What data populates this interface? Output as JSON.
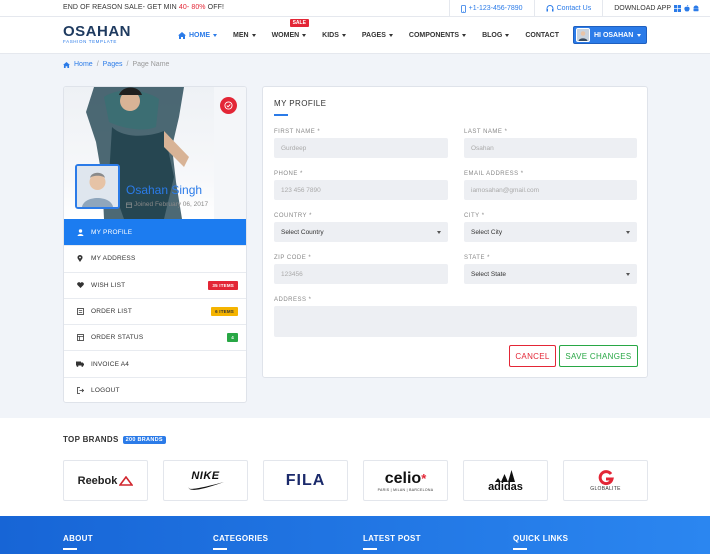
{
  "topbar": {
    "promo_prefix": "END OF REASON SALE- GET MIN ",
    "promo_highlight": "40- 80%",
    "promo_suffix": " OFF!",
    "phone": "+1-123-456-7890",
    "contact": "Contact Us",
    "download": "DOWNLOAD APP"
  },
  "brand": {
    "name": "OSAHAN",
    "tagline": "FASHION TEMPLATE"
  },
  "nav": {
    "items": [
      {
        "label": "HOME",
        "active": true
      },
      {
        "label": "MEN"
      },
      {
        "label": "WOMEN",
        "badge": "SALE"
      },
      {
        "label": "KIDS"
      },
      {
        "label": "PAGES"
      },
      {
        "label": "COMPONENTS"
      },
      {
        "label": "BLOG"
      },
      {
        "label": "CONTACT"
      }
    ],
    "user_button": "HI OSAHAN"
  },
  "breadcrumb": {
    "home": "Home",
    "pages": "Pages",
    "current": "Page Name"
  },
  "profile": {
    "name": "Osahan Singh",
    "joined": "Joined February 06, 2017"
  },
  "side_menu": [
    {
      "label": "MY PROFILE",
      "icon": "user-icon",
      "active": true
    },
    {
      "label": "MY ADDRESS",
      "icon": "map-pin-icon"
    },
    {
      "label": "WISH LIST",
      "icon": "heart-icon",
      "badge": "35 ITEMS",
      "badge_color": "#e32636"
    },
    {
      "label": "ORDER LIST",
      "icon": "list-icon",
      "badge": "6 ITEMS",
      "badge_color": "#f5b400"
    },
    {
      "label": "ORDER STATUS",
      "icon": "status-icon",
      "badge": "4",
      "badge_color": "#28a745"
    },
    {
      "label": "INVOICE A4",
      "icon": "truck-icon"
    },
    {
      "label": "LOGOUT",
      "icon": "logout-icon"
    }
  ],
  "form": {
    "title": "MY PROFILE",
    "first_name_label": "FIRST NAME *",
    "first_name_value": "Gurdeep",
    "last_name_label": "LAST NAME *",
    "last_name_value": "Osahan",
    "phone_label": "PHONE *",
    "phone_value": "123 456 7890",
    "email_label": "EMAIL ADDRESS *",
    "email_value": "iamosahan@gmail.com",
    "country_label": "COUNTRY *",
    "country_value": "Select Country",
    "city_label": "CITY *",
    "city_value": "Select City",
    "zip_label": "ZIP CODE *",
    "zip_value": "123456",
    "state_label": "STATE *",
    "state_value": "Select State",
    "address_label": "ADDRESS *",
    "address_value": "",
    "cancel": "CANCEL",
    "save": "SAVE CHANGES"
  },
  "brands": {
    "title": "TOP BRANDS",
    "badge": "200 BRANDS",
    "items": [
      "Reebok",
      "NIKE",
      "FILA",
      "celio",
      "adidas",
      "GLOBALITE"
    ],
    "celio_tagline": "PARIS | MILAN | BARCELONA"
  },
  "footer": {
    "cols": [
      "ABOUT",
      "CATEGORIES",
      "LATEST POST",
      "QUICK LINKS"
    ]
  }
}
